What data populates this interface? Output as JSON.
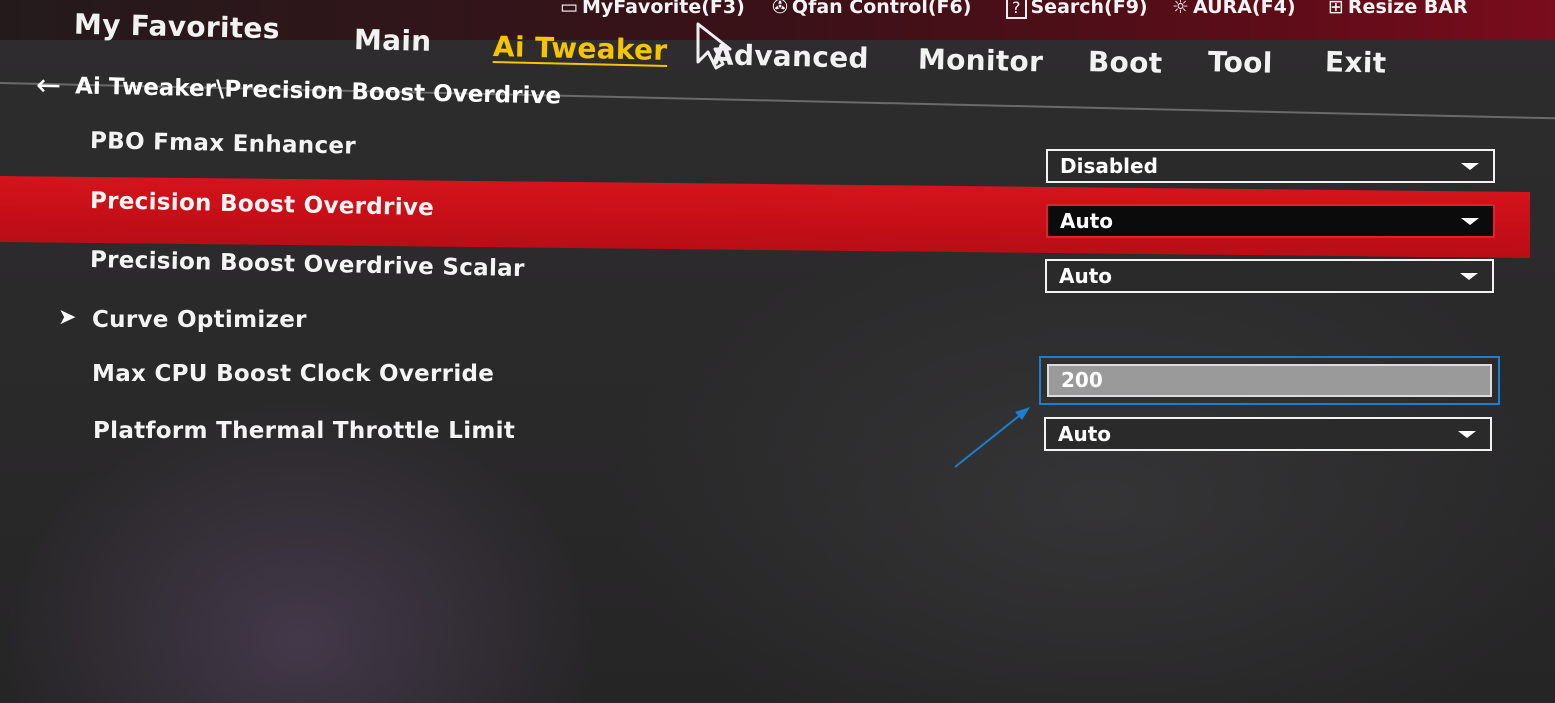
{
  "hotkeys": [
    {
      "label": "MyFavorite(F3)",
      "icon": "star-page-icon",
      "glyph": "▭"
    },
    {
      "label": "Qfan Control(F6)",
      "icon": "fan-icon",
      "glyph": "✇"
    },
    {
      "label": "Search(F9)",
      "icon": "help-icon",
      "glyph": "?"
    },
    {
      "label": "AURA(F4)",
      "icon": "aura-light-icon",
      "glyph": "☼"
    },
    {
      "label": "Resize BAR",
      "icon": "resize-bar-icon",
      "glyph": "⊞"
    }
  ],
  "tabs": [
    {
      "label": "My Favorites",
      "active": false
    },
    {
      "label": "Main",
      "active": false
    },
    {
      "label": "Ai Tweaker",
      "active": true
    },
    {
      "label": "Advanced",
      "active": false
    },
    {
      "label": "Monitor",
      "active": false
    },
    {
      "label": "Boot",
      "active": false
    },
    {
      "label": "Tool",
      "active": false
    },
    {
      "label": "Exit",
      "active": false
    }
  ],
  "breadcrumb": {
    "back_glyph": "←",
    "path": "Ai Tweaker\\Precision Boost Overdrive"
  },
  "settings": [
    {
      "label": "PBO Fmax Enhancer",
      "value": "Disabled",
      "control": "dropdown"
    },
    {
      "label": "Precision Boost Overdrive",
      "value": "Auto",
      "control": "dropdown",
      "selected": true
    },
    {
      "label": "Precision Boost Overdrive Scalar",
      "value": "Auto",
      "control": "dropdown"
    },
    {
      "label": "Curve Optimizer",
      "control": "submenu",
      "arrow": "➤"
    },
    {
      "label": "Max CPU Boost Clock Override",
      "value": "200",
      "control": "input"
    },
    {
      "label": "Platform Thermal Throttle Limit",
      "value": "Auto",
      "control": "dropdown"
    }
  ],
  "colors": {
    "highlight": "#cc121a",
    "active_tab": "#f6c400",
    "annotation": "#1a7fd0"
  }
}
